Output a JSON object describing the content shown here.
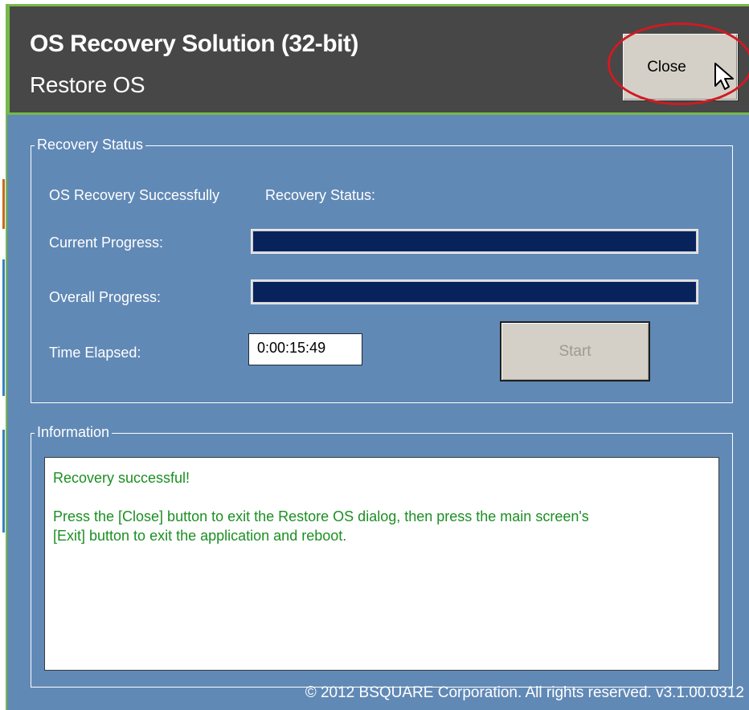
{
  "window": {
    "title": "OS Recovery Solution (32-bit)",
    "subtitle": "Restore OS",
    "close_label": "Close",
    "accent_colors": {
      "header_bg": "#474747",
      "frame_bg": "#6189b6",
      "border_green": "#77b84a",
      "highlight_ring": "#cf1b22"
    }
  },
  "recovery_status": {
    "group_title": "Recovery Status",
    "status_text": "OS Recovery Successfully",
    "status_label": "Recovery Status:",
    "current_progress_label": "Current Progress:",
    "current_progress_value": 100,
    "overall_progress_label": "Overall Progress:",
    "overall_progress_value": 100,
    "time_elapsed_label": "Time Elapsed:",
    "time_elapsed_value": "0:00:15:49",
    "start_label": "Start"
  },
  "information": {
    "group_title": "Information",
    "lines": [
      "Recovery successful!",
      "Press the [Close] button to exit the Restore OS dialog, then press the main screen's",
      "[Exit] button to exit the application and reboot."
    ]
  },
  "footer": {
    "copyright": "© 2012 BSQUARE Corporation. All rights reserved. v3.1.00.0312"
  },
  "icons": {
    "cursor": "mouse-pointer-icon"
  }
}
